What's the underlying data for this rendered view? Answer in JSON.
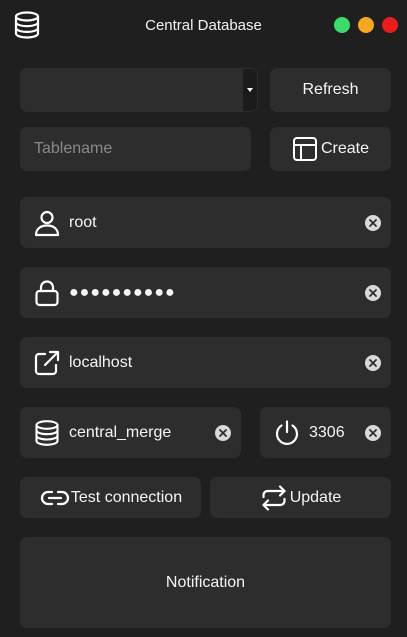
{
  "window": {
    "title": "Central Database",
    "app_icon": "database-icon",
    "traffic_lights": {
      "green": "#3ddc6a",
      "orange": "#f5a623",
      "red": "#e81c1c"
    }
  },
  "toolbar": {
    "combo_value": "",
    "refresh_label": "Refresh",
    "tablename_placeholder": "Tablename",
    "tablename_value": "",
    "create_label": "Create",
    "create_icon": "table-icon"
  },
  "connection": {
    "username": {
      "icon": "user-icon",
      "value": "root"
    },
    "password": {
      "icon": "lock-icon",
      "value": "●●●●●●●●●●"
    },
    "host": {
      "icon": "external-link-icon",
      "value": "localhost"
    },
    "database": {
      "icon": "database-icon",
      "value": "central_merge"
    },
    "port": {
      "icon": "power-icon",
      "value": "3306"
    }
  },
  "actions": {
    "test_label": "Test connection",
    "test_icon": "link-icon",
    "update_label": "Update",
    "update_icon": "repeat-icon"
  },
  "notification": {
    "text": "Notification"
  },
  "colors": {
    "background": "#1f1f1f",
    "panel": "#2d2d2d",
    "text": "#f5f5f5",
    "placeholder": "#8a8a8a"
  }
}
